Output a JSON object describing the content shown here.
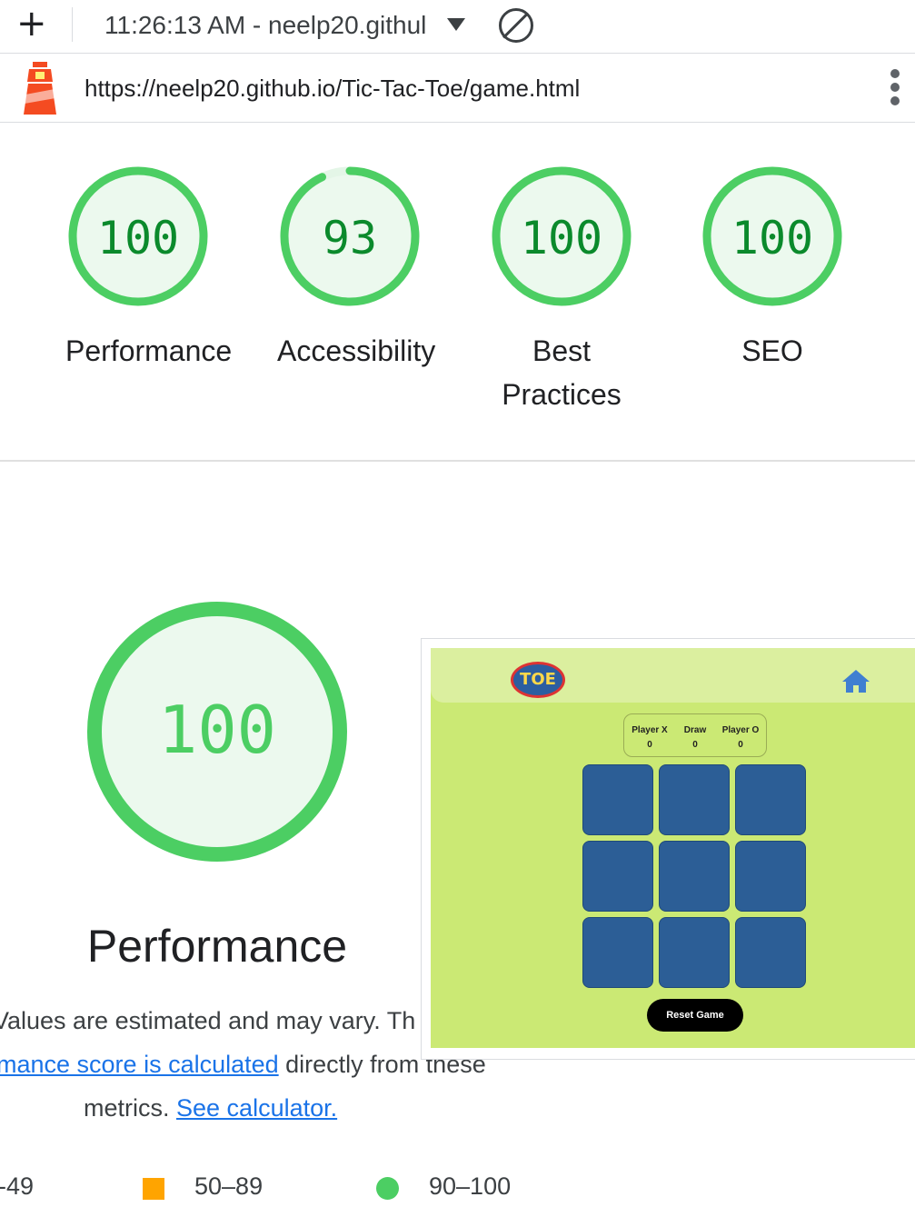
{
  "toolbar": {
    "new_label": "+",
    "selector_text": "11:26:13 AM - neelp20.githul",
    "url": "https://neelp20.github.io/Tic-Tac-Toe/game.html"
  },
  "gauges": [
    {
      "score": "100",
      "label": "Performance",
      "value": 100
    },
    {
      "score": "93",
      "label": "Accessibility",
      "value": 93
    },
    {
      "score": "100",
      "label_line1": "Best",
      "label_line2": "Practices",
      "value": 100
    },
    {
      "score": "100",
      "label": "SEO",
      "value": 100
    }
  ],
  "performance": {
    "score": "100",
    "title": "Performance",
    "desc_line1": "Values are estimated and may vary. Th",
    "desc_link": "mance score is calculated",
    "desc_line2_rest": " directly from these",
    "desc_line3": "metrics.",
    "calc_link": "See calculator."
  },
  "legend": {
    "low": "-49",
    "mid": "50–89",
    "high": "90–100"
  },
  "screenshot": {
    "logo_text": "TOE",
    "score_headers": [
      "Player X",
      "Draw",
      "Player O"
    ],
    "score_values": [
      "0",
      "0",
      "0"
    ],
    "reset_label": "Reset Game"
  },
  "colors": {
    "pass": "#4cce63",
    "pass_bg": "#ecf9ee",
    "average": "#ffa400",
    "link": "#1a73e8",
    "game_bg": "#cbe974",
    "cell": "#2c5e96"
  }
}
